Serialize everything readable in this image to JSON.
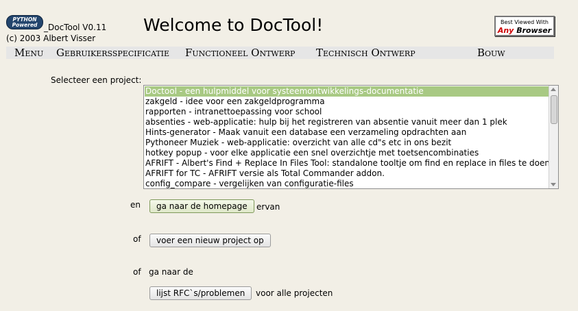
{
  "header": {
    "logo_line1": "PYTHON",
    "logo_line2": "Powered",
    "app_version": "_DocTool V0.11",
    "copyright": "(c) 2003 Albert Visser",
    "title": "Welcome to DocTool!",
    "badge_line1": "Best Viewed With",
    "badge_any": "Any",
    "badge_browser": "Browser"
  },
  "menu": {
    "items": [
      "Menu",
      "Gebruikersspecificatie",
      "Functioneel Ontwerp",
      "Technisch Ontwerp",
      "Bouw"
    ]
  },
  "projects": {
    "label": "Selecteer een project:",
    "selected_index": 0,
    "options": [
      "Doctool - een hulpmiddel voor systeemontwikkelings-documentatie",
      "zakgeld - idee voor een zakgeldprogramma",
      "rapporten - intranettoepassing voor school",
      "absenties - web-applicatie: hulp bij het registreren van absentie vanuit meer dan 1 plek",
      "Hints-generator - Maak vanuit een database een verzameling opdrachten aan",
      "Pythoneer Muziek - web-applicatie: overzicht van alle cd\"s etc in ons bezit",
      "hotkey popup - voor elke applicatie een snel overzichtje met toetsencombinaties",
      "AFRIFT - Albert's Find + Replace In Files Tool: standalone tooltje om find en replace in files te doen",
      "AFRIFT for TC - AFRIFT versie als Total Commander addon.",
      "config_compare - vergelijken van configuratie-files"
    ]
  },
  "actions": {
    "en_label": "en",
    "homepage_button": "ga naar de homepage",
    "ervan_label": "ervan",
    "of_label_1": "of",
    "new_project_button": "voer een nieuw project op",
    "of_label_2": "of",
    "ga_naar_de": "ga naar de",
    "rfc_button": "lijst RFC`s/problemen",
    "all_projects_label": "voor alle projecten"
  }
}
